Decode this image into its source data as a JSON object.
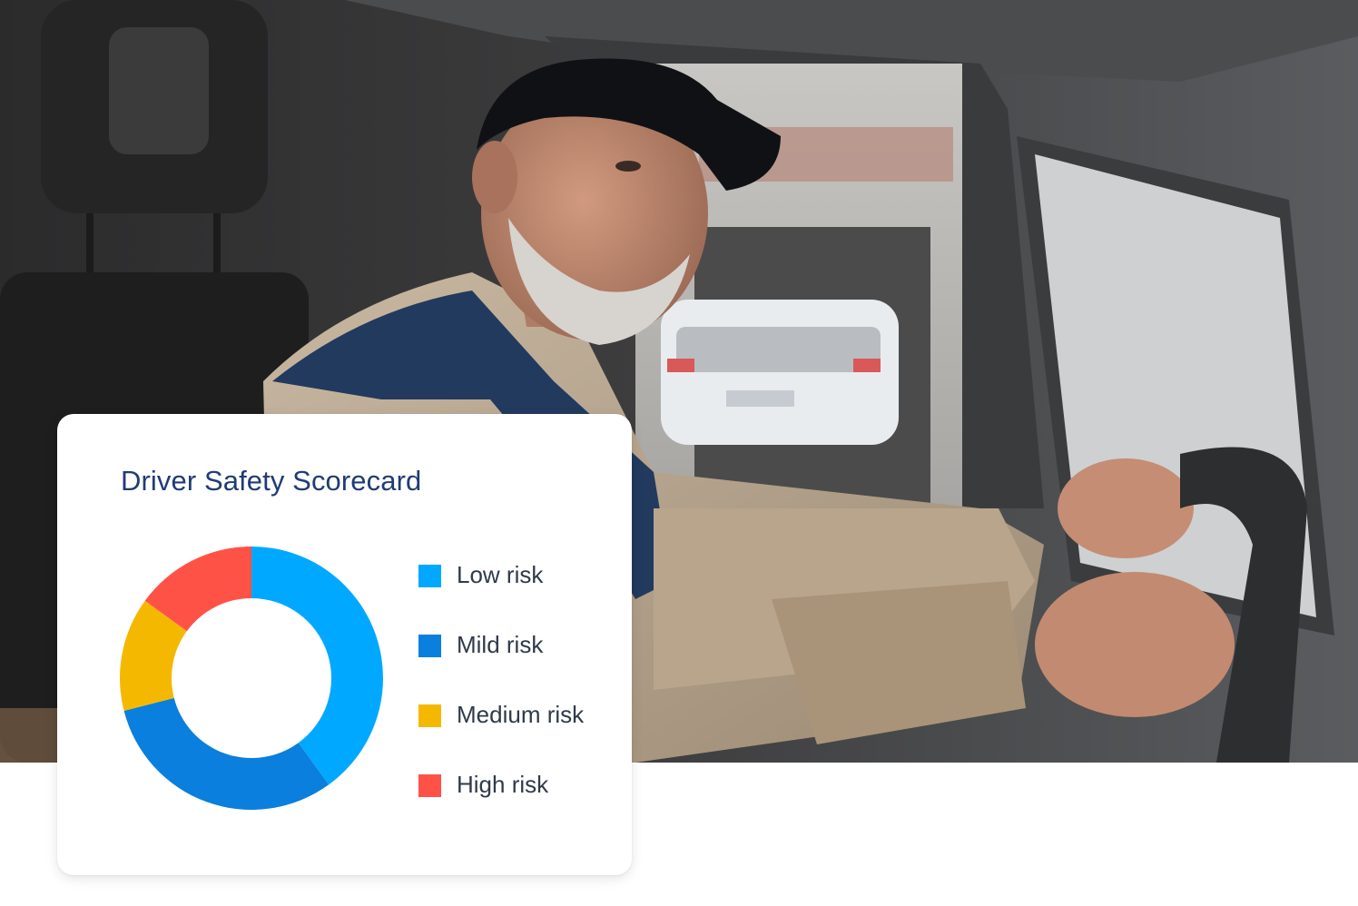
{
  "photo": {
    "description_icon": "driver-in-van-photo"
  },
  "card": {
    "title": "Driver Safety Scorecard"
  },
  "chart_data": {
    "type": "pie",
    "style": "donut",
    "title": "Driver Safety Scorecard",
    "legend_position": "right",
    "categories": [
      "Low risk",
      "Mild risk",
      "Medium risk",
      "High risk"
    ],
    "values": [
      40,
      31,
      14,
      15
    ],
    "colors": [
      "#00a9ff",
      "#0a7fdd",
      "#f5b800",
      "#ff5247"
    ]
  }
}
